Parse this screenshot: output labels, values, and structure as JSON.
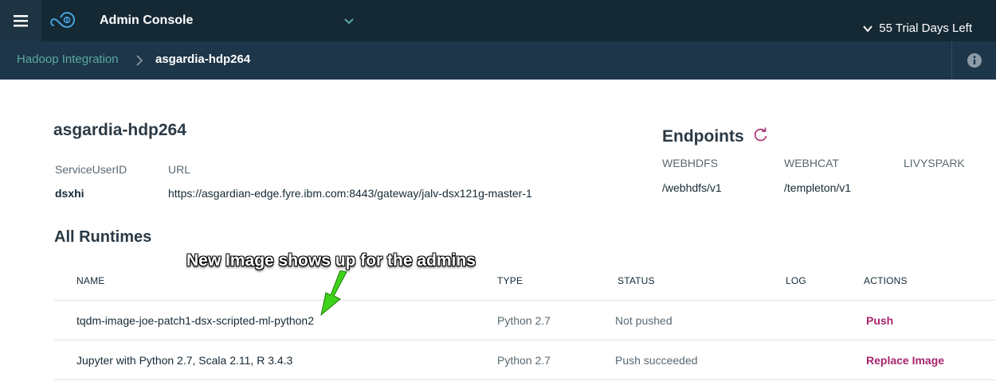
{
  "header": {
    "app_title": "Admin Console",
    "trial_text": "55 Trial Days Left"
  },
  "breadcrumb": {
    "parent": "Hadoop Integration",
    "current": "asgardia-hdp264"
  },
  "cluster": {
    "name": "asgardia-hdp264",
    "label_user": "ServiceUserID",
    "label_url": "URL",
    "user_value": "dsxhi",
    "url_value": "https://asgardian-edge.fyre.ibm.com:8443/gateway/jalv-dsx121g-master-1"
  },
  "endpoints": {
    "title": "Endpoints",
    "columns": [
      "WEBHDFS",
      "WEBHCAT",
      "LIVYSPARK"
    ],
    "values": [
      "/webhdfs/v1",
      "/templeton/v1",
      ""
    ]
  },
  "runtimes": {
    "title": "All Runtimes",
    "headers": [
      "NAME",
      "TYPE",
      "STATUS",
      "LOG",
      "ACTIONS"
    ],
    "rows": [
      {
        "name": "tqdm-image-joe-patch1-dsx-scripted-ml-python2",
        "type": "Python 2.7",
        "status": "Not pushed",
        "log": "",
        "action": "Push"
      },
      {
        "name": "Jupyter with Python 2.7, Scala 2.11, R 3.4.3",
        "type": "Python 2.7",
        "status": "Push succeeded",
        "log": "",
        "action": "Replace Image"
      }
    ]
  },
  "annotation": {
    "text": "New Image shows up for the admins"
  },
  "colors": {
    "topbar": "#152935",
    "subbar": "#1d3649",
    "breadcrumb_link": "#5aa9a3",
    "accent_action": "#a6266e",
    "annotation_arrow": "#3fd21a"
  },
  "icons": [
    "menu-icon",
    "cloud-logo-icon",
    "chevron-down-icon",
    "chevron-right-icon",
    "info-icon",
    "refresh-icon",
    "arrow-annotation-icon"
  ]
}
